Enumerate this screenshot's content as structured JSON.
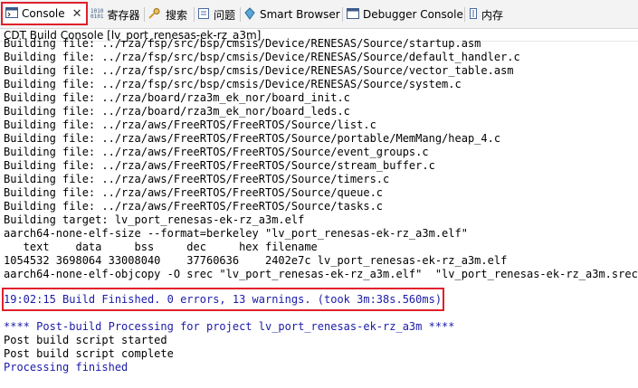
{
  "tabs": [
    {
      "label": "Console",
      "icon": "console-icon",
      "active": true
    },
    {
      "label": "寄存器",
      "icon": "registers-icon"
    },
    {
      "label": "搜索",
      "icon": "search-icon"
    },
    {
      "label": "问题",
      "icon": "problems-icon"
    },
    {
      "label": "Smart Browser",
      "icon": "smart-browser-icon"
    },
    {
      "label": "Debugger Console",
      "icon": "debugger-console-icon"
    },
    {
      "label": "内存",
      "icon": "memory-icon"
    }
  ],
  "console": {
    "title": "CDT Build Console [lv_port_renesas-ek-rz_a3m]",
    "lines": [
      "Building file: ../rza/fsp/src/bsp/cmsis/Device/RENESAS/Source/startup.asm",
      "Building file: ../rza/fsp/src/bsp/cmsis/Device/RENESAS/Source/default_handler.c",
      "Building file: ../rza/fsp/src/bsp/cmsis/Device/RENESAS/Source/vector_table.asm",
      "Building file: ../rza/fsp/src/bsp/cmsis/Device/RENESAS/Source/system.c",
      "Building file: ../rza/board/rza3m_ek_nor/board_init.c",
      "Building file: ../rza/board/rza3m_ek_nor/board_leds.c",
      "Building file: ../rza/aws/FreeRTOS/FreeRTOS/Source/list.c",
      "Building file: ../rza/aws/FreeRTOS/FreeRTOS/Source/portable/MemMang/heap_4.c",
      "Building file: ../rza/aws/FreeRTOS/FreeRTOS/Source/event_groups.c",
      "Building file: ../rza/aws/FreeRTOS/FreeRTOS/Source/stream_buffer.c",
      "Building file: ../rza/aws/FreeRTOS/FreeRTOS/Source/timers.c",
      "Building file: ../rza/aws/FreeRTOS/FreeRTOS/Source/queue.c",
      "Building file: ../rza/aws/FreeRTOS/FreeRTOS/Source/tasks.c",
      "Building target: lv_port_renesas-ek-rz_a3m.elf",
      "aarch64-none-elf-size --format=berkeley \"lv_port_renesas-ek-rz_a3m.elf\"",
      "   text    data     bss     dec     hex filename",
      "1054532 3698064 33008040    37760636    2402e7c lv_port_renesas-ek-rz_a3m.elf",
      "aarch64-none-elf-objcopy -O srec \"lv_port_renesas-ek-rz_a3m.elf\"  \"lv_port_renesas-ek-rz_a3m.srec\""
    ],
    "build_finished": "19:02:15 Build Finished. 0 errors, 13 warnings. (took 3m:38s.560ms)",
    "post_build_header": "**** Post-build Processing for project lv_port_renesas-ek-rz_a3m ****",
    "post_build_lines": [
      "Post build script started",
      "Post build script complete"
    ],
    "processing_finished": "Processing finished"
  },
  "colors": {
    "highlight": "#e0202c",
    "info_text": "#1a1aa8"
  }
}
